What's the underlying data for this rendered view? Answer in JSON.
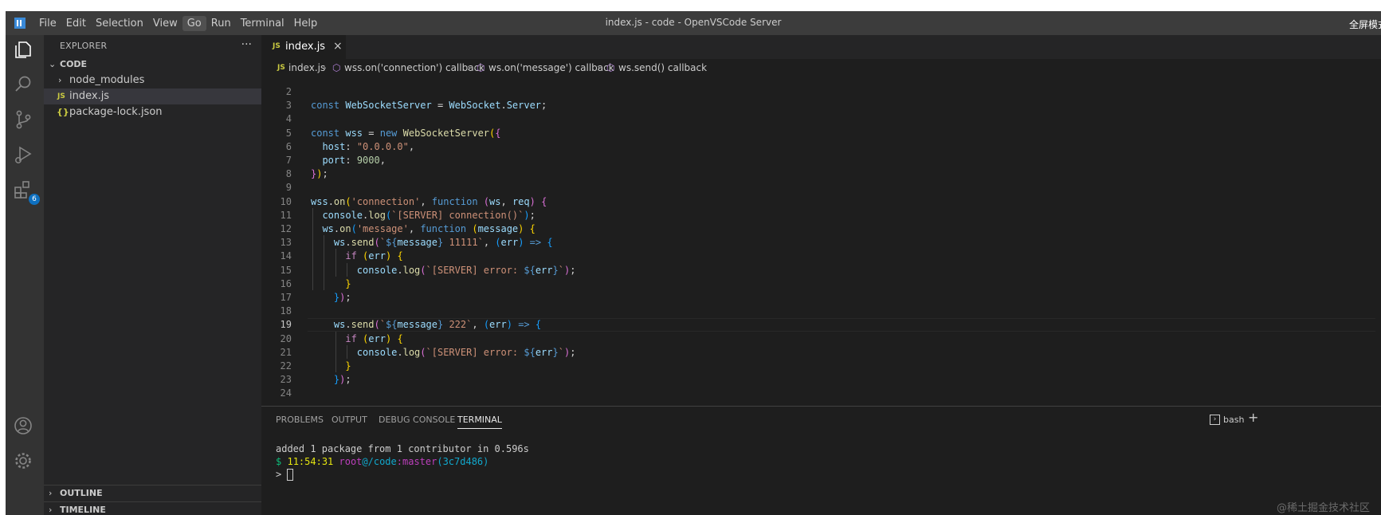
{
  "window": {
    "title": "index.js - code - OpenVSCode Server",
    "fullscreen_label": "全屏模式"
  },
  "menu": [
    "File",
    "Edit",
    "Selection",
    "View",
    "Go",
    "Run",
    "Terminal",
    "Help"
  ],
  "activity": {
    "extensions_badge": "6"
  },
  "sidebar": {
    "title": "EXPLORER",
    "more": "···",
    "folder": "CODE",
    "items": [
      {
        "label": "node_modules"
      },
      {
        "label": "index.js",
        "icon": "JS"
      },
      {
        "label": "package-lock.json",
        "icon": "{}"
      }
    ],
    "outline": "OUTLINE",
    "timeline": "TIMELINE"
  },
  "tabs": [
    {
      "label": "index.js",
      "icon": "JS",
      "close": "×"
    }
  ],
  "breadcrumb": {
    "file_icon": "JS",
    "file": "index.js",
    "items": [
      "wss.on('connection') callback",
      "ws.on('message') callback",
      "ws.send() callback"
    ]
  },
  "editor": {
    "current_line": 19,
    "lines": [
      {
        "n": "2",
        "text": ""
      },
      {
        "n": "3",
        "text": "const WebSocketServer = WebSocket.Server;"
      },
      {
        "n": "4",
        "text": ""
      },
      {
        "n": "5",
        "text": "const wss = new WebSocketServer({"
      },
      {
        "n": "6",
        "text": "  host: \"0.0.0.0\","
      },
      {
        "n": "7",
        "text": "  port: 9000,"
      },
      {
        "n": "8",
        "text": "});"
      },
      {
        "n": "9",
        "text": ""
      },
      {
        "n": "10",
        "text": "wss.on('connection', function (ws, req) {"
      },
      {
        "n": "11",
        "text": "  console.log(`[SERVER] connection()`);"
      },
      {
        "n": "12",
        "text": "  ws.on('message', function (message) {"
      },
      {
        "n": "13",
        "text": "    ws.send(`${message} 11111`, (err) => {"
      },
      {
        "n": "14",
        "text": "      if (err) {"
      },
      {
        "n": "15",
        "text": "        console.log(`[SERVER] error: ${err}`);"
      },
      {
        "n": "16",
        "text": "      }"
      },
      {
        "n": "17",
        "text": "    });"
      },
      {
        "n": "18",
        "text": ""
      },
      {
        "n": "19",
        "text": "    ws.send(`${message} 222`, (err) => {"
      },
      {
        "n": "20",
        "text": "      if (err) {"
      },
      {
        "n": "21",
        "text": "        console.log(`[SERVER] error: ${err}`);"
      },
      {
        "n": "22",
        "text": "      }"
      },
      {
        "n": "23",
        "text": "    });"
      },
      {
        "n": "24",
        "text": ""
      }
    ]
  },
  "panel": {
    "tabs": [
      "PROBLEMS",
      "OUTPUT",
      "DEBUG CONSOLE",
      "TERMINAL"
    ],
    "active_tab": "TERMINAL",
    "shell": "bash",
    "add": "+",
    "terminal": {
      "line1": "added 1 package from 1 contributor in 0.596s",
      "prompt_symbol": "$",
      "time": "11:54:31",
      "user": "root",
      "at_path": "@/code",
      "branch_label": ":master",
      "commit": "(3c7d486)",
      "prompt2": "> "
    }
  },
  "watermark": "@稀土掘金技术社区",
  "colors": {
    "editor_bg": "#1e1e1e",
    "sidebar_bg": "#252526",
    "activity_bg": "#333333",
    "titlebar_bg": "#3c3c3c",
    "badge": "#0e70c0"
  }
}
